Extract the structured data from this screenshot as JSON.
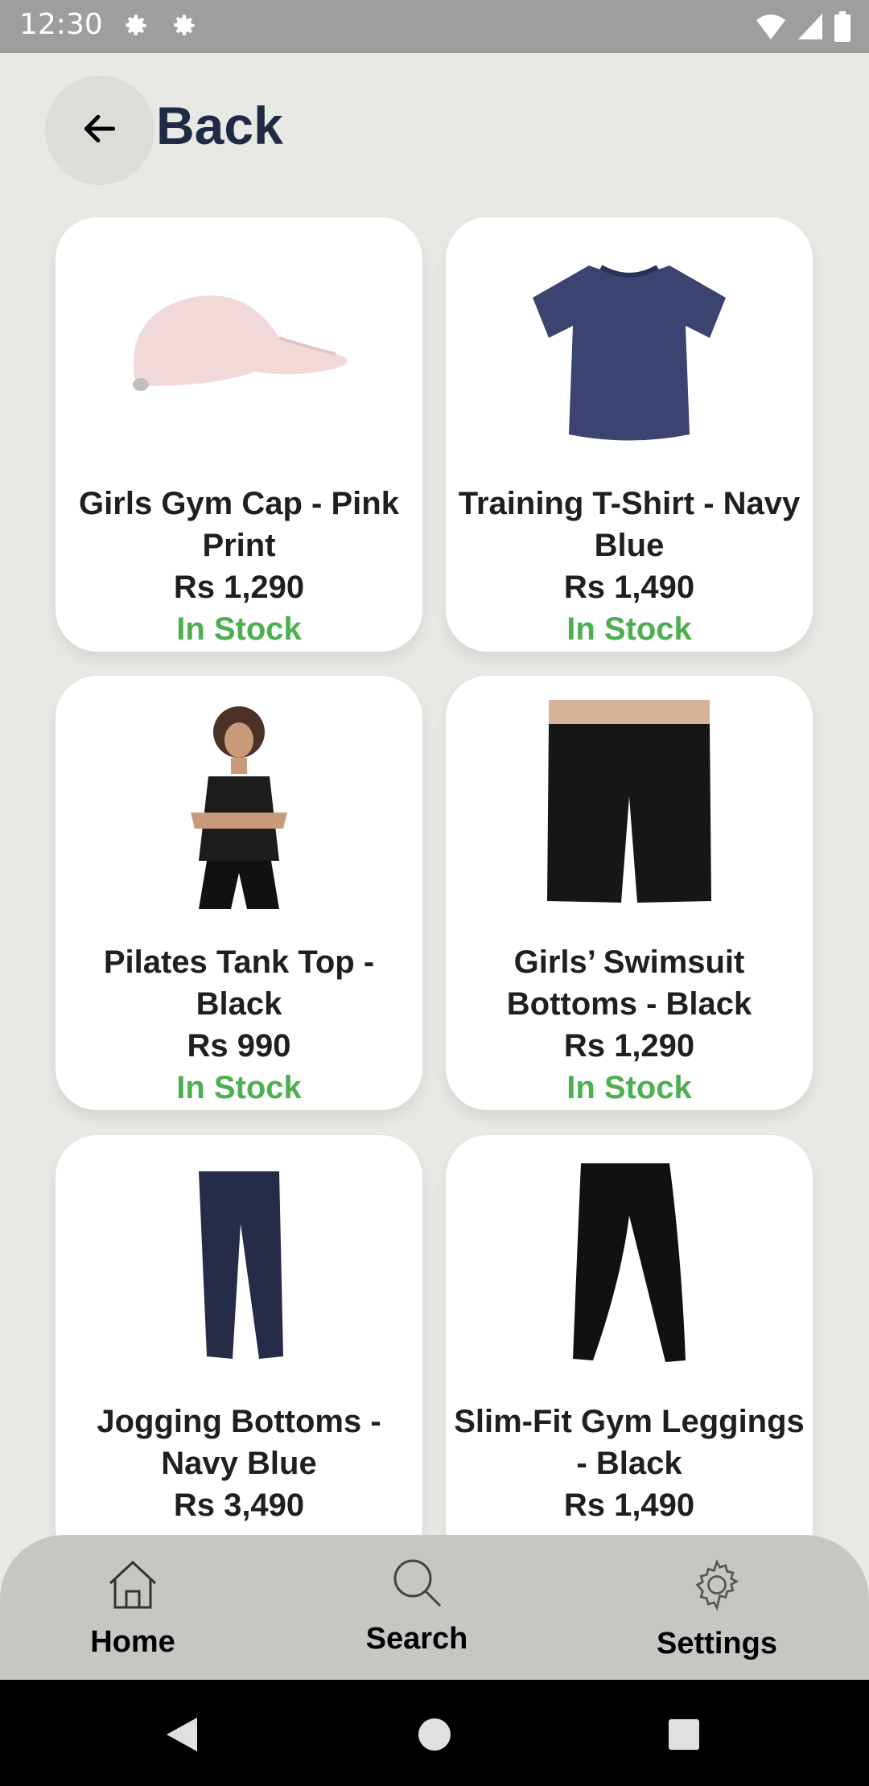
{
  "status_bar": {
    "time": "12:30"
  },
  "header": {
    "back_label": "Back"
  },
  "products": [
    {
      "name": "Girls Gym Cap - Pink Print",
      "price": "Rs 1,290",
      "stock": "In Stock",
      "image": "pink-cap"
    },
    {
      "name": "Training T-Shirt - Navy Blue",
      "price": "Rs 1,490",
      "stock": "In Stock",
      "image": "navy-tshirt"
    },
    {
      "name": "Pilates Tank Top - Black",
      "price": "Rs 990",
      "stock": "In Stock",
      "image": "black-tank-top"
    },
    {
      "name": "Girls’ Swimsuit Bottoms - Black",
      "price": "Rs 1,290",
      "stock": "In Stock",
      "image": "black-swim-bottoms"
    },
    {
      "name": "Jogging Bottoms - Navy Blue",
      "price": "Rs 3,490",
      "stock": "",
      "image": "navy-jogging-bottoms"
    },
    {
      "name": "Slim-Fit Gym Leggings - Black",
      "price": "Rs 1,490",
      "stock": "",
      "image": "black-leggings"
    }
  ],
  "bottom_nav": {
    "home": "Home",
    "search": "Search",
    "settings": "Settings"
  },
  "colors": {
    "stock_green": "#4caf50",
    "title_navy": "#1f2a44"
  }
}
